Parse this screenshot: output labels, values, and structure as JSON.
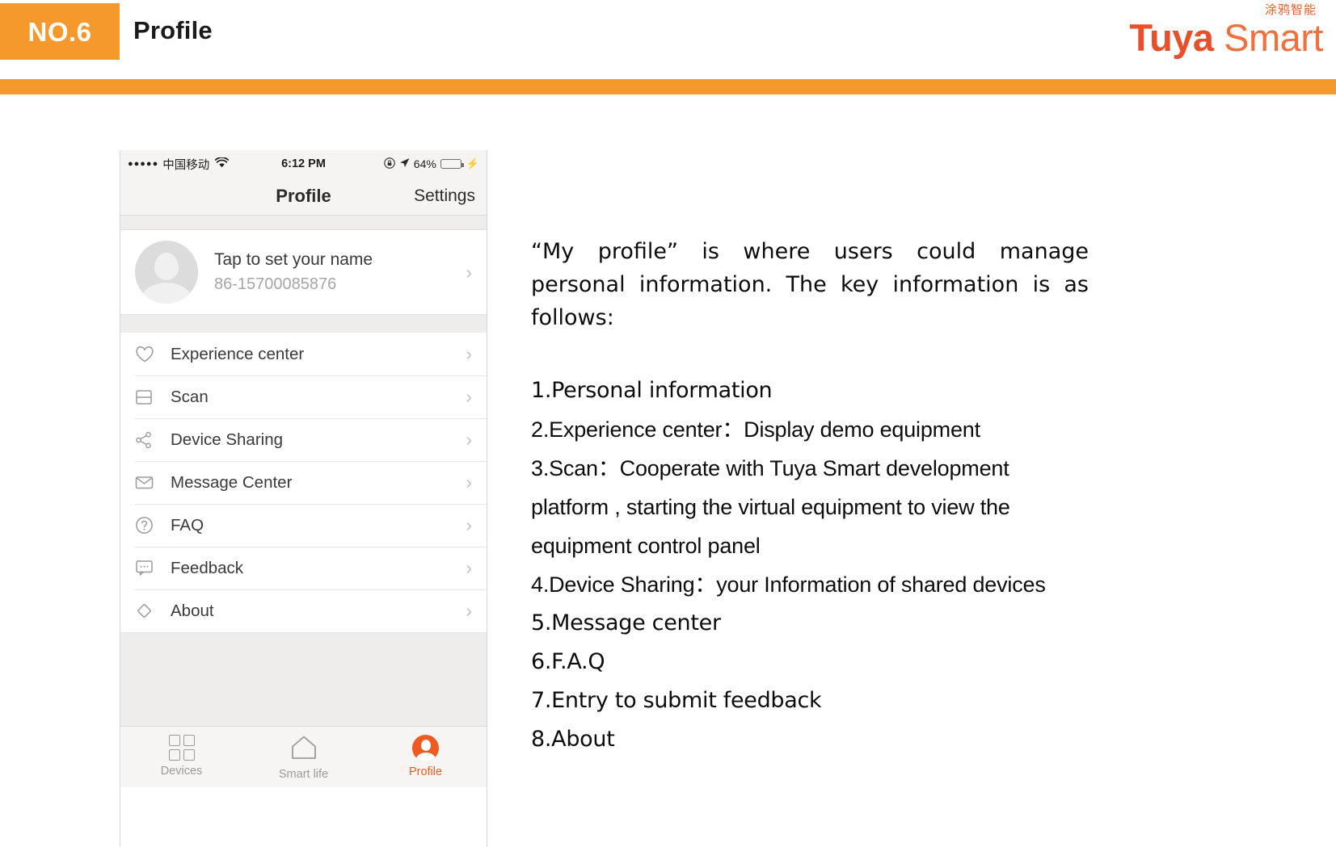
{
  "header": {
    "badge": "NO.6",
    "title": "Profile",
    "accent_color": "#F5992C"
  },
  "logo": {
    "chinese": "涂鸦智能",
    "brand_bold": "Tuya",
    "brand_light": "Smart",
    "color_bold": "#E8502A",
    "color_light": "#F0713E"
  },
  "phone": {
    "status_bar": {
      "signal_dots": "●●●●●",
      "carrier": "中国移动",
      "wifi_icon": "wifi-icon",
      "time": "6:12 PM",
      "alarm_icon": "rotation-lock-icon",
      "location_icon": "location-arrow-icon",
      "battery_percent": "64%",
      "battery_level": 64,
      "battery_color": "#4CD964",
      "charging_icon": "lightning-bolt-icon"
    },
    "nav_bar": {
      "title": "Profile",
      "right_action": "Settings"
    },
    "profile": {
      "name": "Tap to set your name",
      "phone_number": "86-15700085876",
      "avatar_icon": "avatar-placeholder-icon",
      "chevron": "›"
    },
    "menu_items": [
      {
        "label": "Experience center",
        "icon": "heart-icon",
        "chevron": "›"
      },
      {
        "label": "Scan",
        "icon": "scan-icon",
        "chevron": "›"
      },
      {
        "label": "Device Sharing",
        "icon": "share-icon",
        "chevron": "›"
      },
      {
        "label": "Message Center",
        "icon": "envelope-icon",
        "chevron": "›"
      },
      {
        "label": "FAQ",
        "icon": "question-circle-icon",
        "chevron": "›"
      },
      {
        "label": "Feedback",
        "icon": "speech-bubble-icon",
        "chevron": "›"
      },
      {
        "label": "About",
        "icon": "diamond-icon",
        "chevron": "›"
      }
    ],
    "tabs": [
      {
        "label": "Devices",
        "icon": "grid-icon",
        "active": false
      },
      {
        "label": "Smart life",
        "icon": "home-icon",
        "active": false
      },
      {
        "label": "Profile",
        "icon": "person-icon",
        "active": true
      }
    ],
    "active_tab_color": "#ED5B21"
  },
  "content": {
    "intro": "“My profile” is where users could manage personal information. The key information is as follows:",
    "items": [
      "1.Personal information",
      "2.Experience center：Display demo equipment",
      "3.Scan：Cooperate with Tuya Smart development platform , starting the virtual equipment to view the equipment control panel",
      "4.Device Sharing：your Information of shared devices",
      "5.Message center",
      "6.F.A.Q",
      "7.Entry to submit feedback",
      "8.About"
    ]
  }
}
